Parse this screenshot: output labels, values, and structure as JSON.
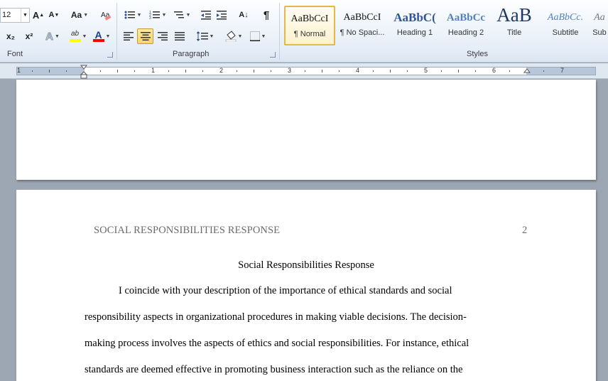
{
  "ribbon": {
    "font": {
      "size_value": "12",
      "grow_label": "A",
      "shrink_label": "A",
      "change_case_label": "Aa",
      "subscript_label": "x₂",
      "superscript_label": "x²",
      "text_effects_label": "A",
      "highlight_label": "ab",
      "font_color_label": "A",
      "group_label": "Font",
      "highlight_color": "#ffff00",
      "font_color": "#ff0000"
    },
    "paragraph": {
      "show_marks_label": "¶",
      "sort_label": "A↓",
      "group_label": "Paragraph",
      "active_alignment": "center"
    },
    "styles": {
      "group_label": "Styles",
      "items": [
        {
          "preview": "AaBbCcI",
          "name": "¶ Normal",
          "selected": true
        },
        {
          "preview": "AaBbCcI",
          "name": "¶ No Spaci..."
        },
        {
          "preview": "AaBbC(",
          "name": "Heading 1"
        },
        {
          "preview": "AaBbCc",
          "name": "Heading 2"
        },
        {
          "preview": "AaB",
          "name": "Title"
        },
        {
          "preview": "AaBbCc.",
          "name": "Subtitle"
        },
        {
          "preview": "Aa",
          "name": "Sub"
        }
      ]
    }
  },
  "ruler": {
    "numbers": [
      "1",
      "1",
      "2",
      "3",
      "4",
      "5",
      "6",
      "7"
    ]
  },
  "document": {
    "page2": {
      "running_head": "SOCIAL RESPONSIBILITIES RESPONSE",
      "page_number": "2",
      "title": "Social Responsibilities Response",
      "lines": [
        "I coincide with your description of the importance of ethical standards and social",
        "responsibility aspects in organizational procedures in making viable decisions. The decision-",
        "making process involves the aspects of ethics and social responsibilities.  For instance, ethical",
        "standards are deemed effective in promoting business interaction such as the reliance  on the"
      ]
    }
  }
}
